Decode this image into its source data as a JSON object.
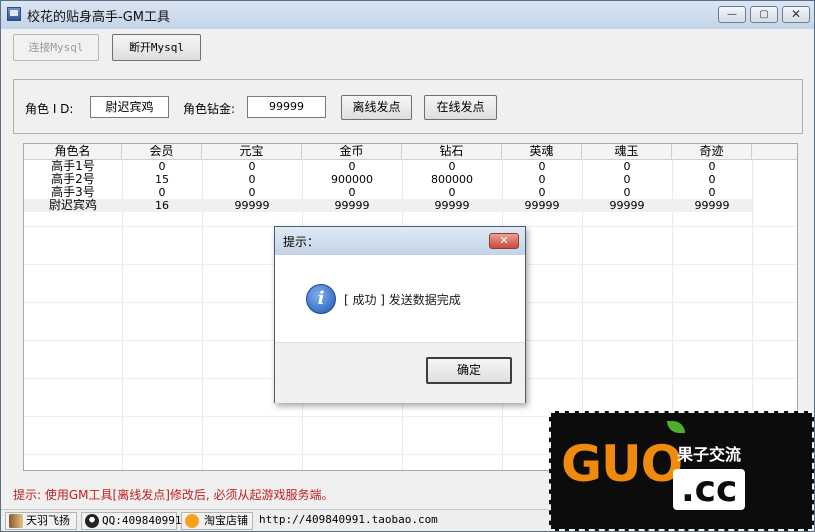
{
  "window": {
    "title": "校花的贴身高手-GM工具",
    "min": "—",
    "max": "▢",
    "close": "✕"
  },
  "toolbar": {
    "connect": "连接Mysql",
    "disconnect": "断开Mysql"
  },
  "form": {
    "role_id_label": "角色 I D:",
    "role_id_value": "尉迟宾鸡",
    "diamond_label": "角色钻金:",
    "diamond_value": "99999",
    "offline_send": "离线发点",
    "online_send": "在线发点"
  },
  "table": {
    "columns": [
      "角色名",
      "会员",
      "元宝",
      "金币",
      "钻石",
      "英魂",
      "魂玉",
      "奇迹"
    ],
    "rows": [
      [
        "高手1号",
        "0",
        "0",
        "0",
        "0",
        "0",
        "0",
        "0"
      ],
      [
        "高手2号",
        "15",
        "0",
        "900000",
        "800000",
        "0",
        "0",
        "0"
      ],
      [
        "高手3号",
        "0",
        "0",
        "0",
        "0",
        "0",
        "0",
        "0"
      ],
      [
        "尉迟宾鸡",
        "16",
        "99999",
        "99999",
        "99999",
        "99999",
        "99999",
        "99999"
      ]
    ],
    "selected_row": 3
  },
  "dialog": {
    "title": "提示：",
    "close": "✕",
    "icon": "info-icon",
    "message": "[ 成功 ] 发送数据完成",
    "ok": "确定"
  },
  "hint": "提示: 使用GM工具[离线发点]修改后, 必须从起游戏服务端。",
  "status": {
    "author": "天羽飞扬",
    "qq": "QQ:409840991",
    "shop": "淘宝店铺",
    "url": "http://409840991.taobao.com"
  },
  "watermark": {
    "logo": "GUO",
    "cn": "果子交流",
    "cc": ".cc"
  },
  "colors": {
    "hint": "#c02020",
    "watermark_orange": "#f08a0c",
    "titlebar": "#c3d4e8"
  }
}
